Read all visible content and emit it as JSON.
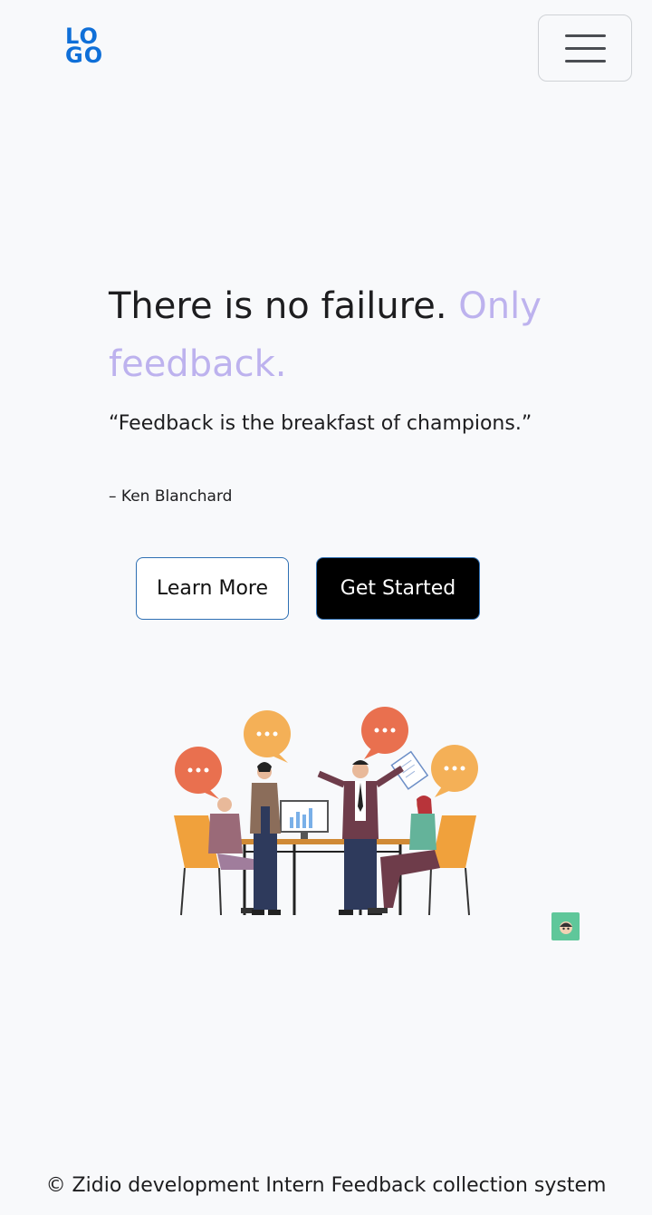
{
  "header": {
    "logo_line1": "LO",
    "logo_line2": "GO",
    "menu_icon": "hamburger-icon"
  },
  "hero": {
    "headline_main": "There is no failure. ",
    "headline_accent": "Only feedback.",
    "quote": "“Feedback is the breakfast of champions.”",
    "author": "– Ken Blanchard",
    "learn_more_label": "Learn More",
    "get_started_label": "Get Started"
  },
  "colors": {
    "accent": "#bdb2ee",
    "logo": "#0f6fd8",
    "primary_button": "#000000",
    "button_border": "#2e6fb3",
    "chat_widget": "#5fc79a"
  },
  "footer": {
    "copyright": "© Zidio development Intern Feedback collection system"
  }
}
